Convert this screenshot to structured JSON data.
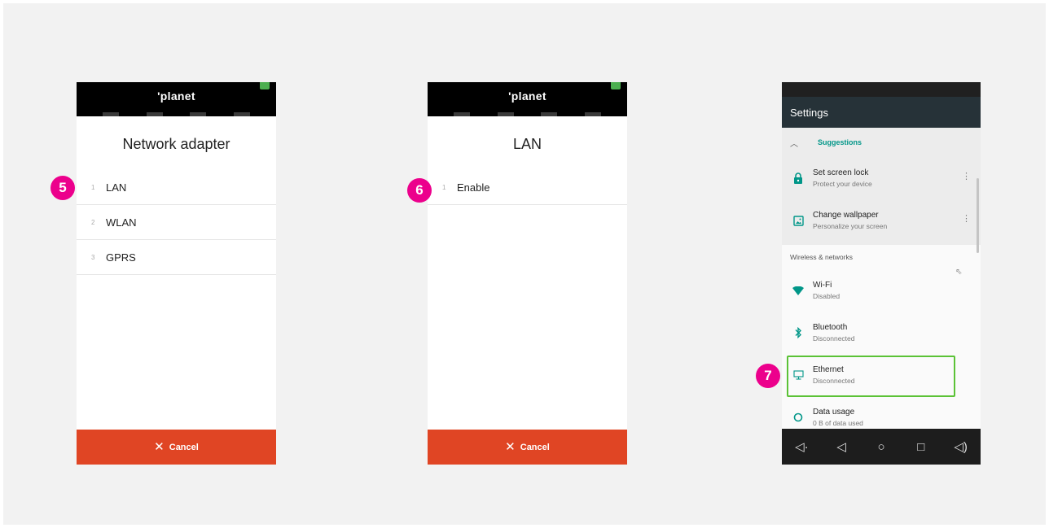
{
  "screen1": {
    "logo": "'planet",
    "title": "Network adapter",
    "items": [
      {
        "num": "1",
        "label": "LAN"
      },
      {
        "num": "2",
        "label": "WLAN"
      },
      {
        "num": "3",
        "label": "GPRS"
      }
    ],
    "cancel_label": "Cancel"
  },
  "screen2": {
    "logo": "'planet",
    "title": "LAN",
    "items": [
      {
        "num": "1",
        "label": "Enable"
      }
    ],
    "cancel_label": "Cancel"
  },
  "settings": {
    "toolbar_title": "Settings",
    "suggestions_label": "Suggestions",
    "suggestions": [
      {
        "title": "Set screen lock",
        "subtitle": "Protect your device",
        "icon": "lock-icon"
      },
      {
        "title": "Change wallpaper",
        "subtitle": "Personalize your screen",
        "icon": "wallpaper-icon"
      }
    ],
    "section_label": "Wireless & networks",
    "items": [
      {
        "title": "Wi-Fi",
        "subtitle": "Disabled",
        "icon": "wifi-icon"
      },
      {
        "title": "Bluetooth",
        "subtitle": "Disconnected",
        "icon": "bluetooth-icon"
      },
      {
        "title": "Ethernet",
        "subtitle": "Disconnected",
        "icon": "ethernet-icon"
      },
      {
        "title": "Data usage",
        "subtitle": "0 B of data used",
        "icon": "data-usage-icon"
      }
    ],
    "highlight_color": "#5bc236"
  },
  "badges": {
    "step5": "5",
    "step6": "6",
    "step7": "7",
    "color": "#ec008c"
  },
  "colors": {
    "cancel": "#e04524",
    "accent": "#009688",
    "toolbar": "#263238"
  }
}
